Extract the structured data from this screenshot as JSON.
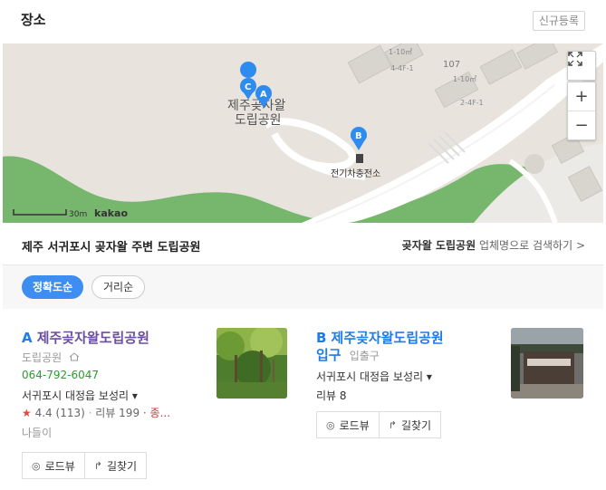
{
  "header": {
    "title": "장소",
    "register_label": "신규등록"
  },
  "map": {
    "place_label_line1": "제주곶자왈",
    "place_label_line2": "도립공원",
    "charging_label": "전기차충전소",
    "markers": [
      "C",
      "A",
      "B"
    ],
    "building_number": "107",
    "road_labels": [
      "1-10㎡",
      "4-4F-1",
      "1-10㎡",
      "2-4F-1"
    ],
    "scale_label": "30m",
    "brand": "kakao"
  },
  "search": {
    "area_label": "제주 서귀포시 곶자왈 주변 도립공원",
    "keyword": "곶자왈 도립공원",
    "suffix": "업체명으로 검색하기 >"
  },
  "sort": {
    "accuracy": "정확도순",
    "distance": "거리순"
  },
  "results": [
    {
      "letter": "A",
      "name": "제주곶자왈도립공원",
      "category": "도립공원",
      "phone": "064-792-6047",
      "address": "서귀포시 대정읍 보성리 ▾",
      "rating": "4.4",
      "rating_count": "(113)",
      "reviews": "리뷰 199",
      "extra": "· 종...",
      "note": "나들이",
      "actions": [
        "로드뷰",
        "길찾기"
      ]
    },
    {
      "letter": "B",
      "name_line1": "제주곶자왈도립공원",
      "name_line2": "입구",
      "category": "입출구",
      "address": "서귀포시 대정읍 보성리 ▾",
      "reviews": "리뷰 8",
      "actions": [
        "로드뷰",
        "길찾기"
      ]
    }
  ],
  "colors": {
    "accent": "#1d7ce7",
    "chip_active": "#3d8ef0",
    "phone": "#2f9a33",
    "star": "#e5493b"
  },
  "icons": [
    "expand-icon",
    "zoom-in-icon",
    "zoom-out-icon",
    "home-icon",
    "star-icon",
    "roadview-icon",
    "directions-icon"
  ]
}
